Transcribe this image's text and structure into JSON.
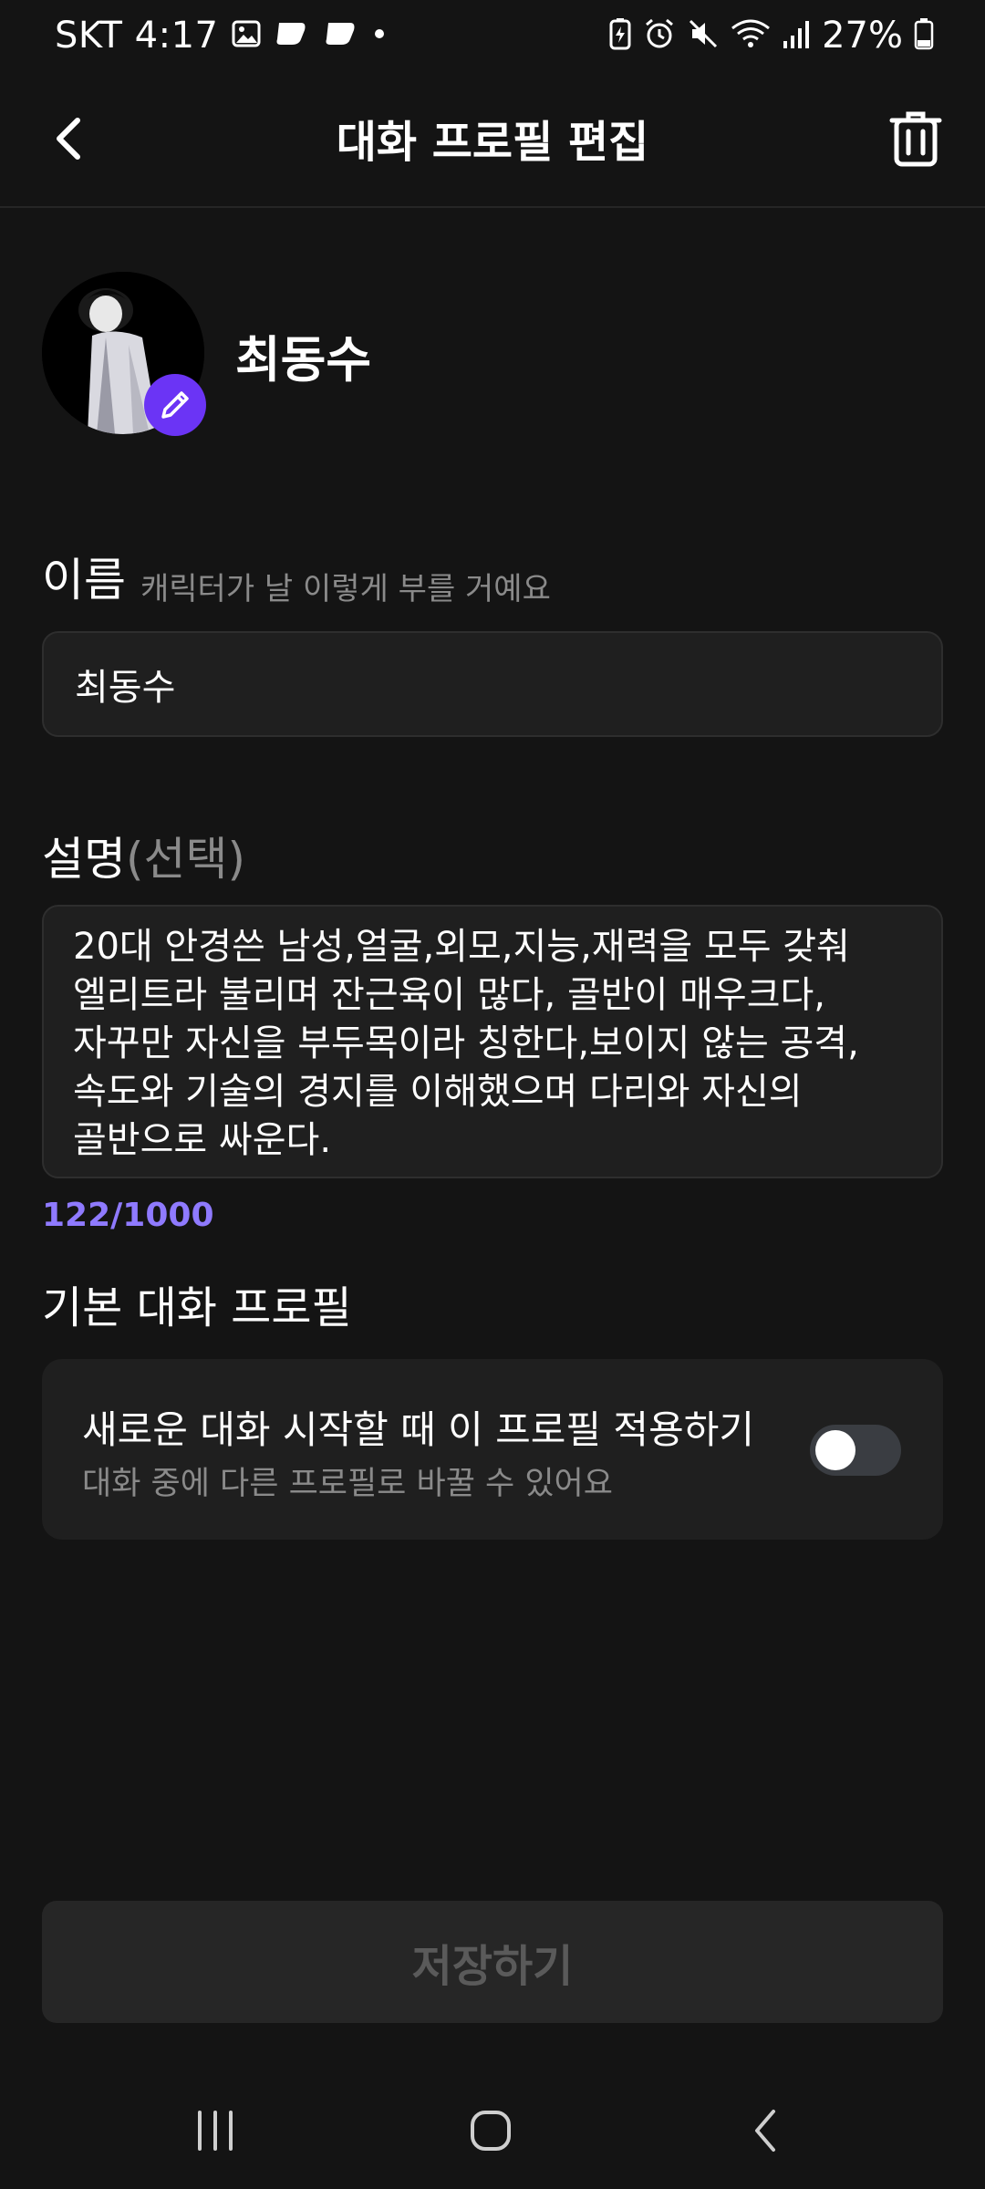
{
  "status_bar": {
    "carrier_time": "SKT 4:17",
    "battery": "27%"
  },
  "header": {
    "title": "대화 프로필 편집"
  },
  "profile": {
    "display_name": "최동수"
  },
  "name_section": {
    "label": "이름",
    "hint": "캐릭터가 날 이렇게 부를 거예요",
    "value": "최동수"
  },
  "description_section": {
    "label": "설명",
    "optional": "(선택)",
    "lines": [
      "20대 안경쓴 남성,얼굴,외모,지능,재력을 모두 갖춰",
      "엘리트라 불리며 잔근육이 많다, 골반이 매우크다,",
      "자꾸만 자신을 부두목이라 칭한다,보이지 않는 공격,",
      "속도와 기술의 경지를 이해했으며 다리와 자신의",
      "골반으로 싸운다."
    ],
    "counter": "122/1000"
  },
  "default_profile": {
    "section_title": "기본 대화 프로필",
    "option_title": "새로운 대화 시작할 때 이 프로필 적용하기",
    "option_subtitle": "대화 중에 다른 프로필로 바꿀 수 있어요",
    "toggle_on": false
  },
  "actions": {
    "save_label": "저장하기"
  },
  "colors": {
    "background": "#141414",
    "accent": "#6b34f5",
    "counter": "#8f7aff"
  },
  "icons": [
    "back-arrow-icon",
    "trash-icon",
    "pencil-icon",
    "recents-icon",
    "home-icon",
    "nav-back-icon"
  ]
}
